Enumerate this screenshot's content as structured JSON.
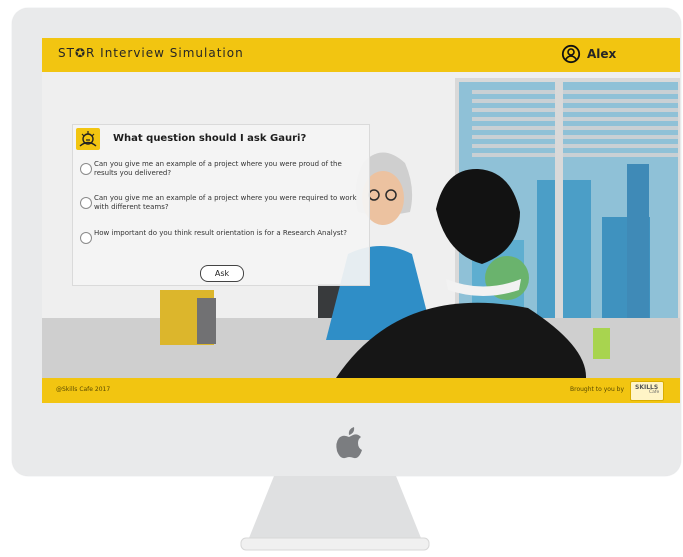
{
  "app": {
    "title": "ST✪R Interview Simulation",
    "user_name": "Alex"
  },
  "question_panel": {
    "question": "What question should I ask Gauri?",
    "options": [
      "Can you give me an example of a project where you were proud of the results you delivered?",
      "Can you give me an example of a project where you were required to work with different teams?",
      "How important do you think result orientation is for a Research Analyst?"
    ],
    "ask_label": "Ask"
  },
  "footer": {
    "copyright": "@Skills Cafe 2017",
    "brought_by": "Brought to you by",
    "logo_text": "SKILLS",
    "logo_sub": "Cafe"
  },
  "colors": {
    "accent": "#f2c511",
    "monitor": "#e9eaeb",
    "woman_shirt": "#2f8ec7",
    "man_hair": "#121212",
    "chair": "#35373a",
    "desk": "#cfcfcf",
    "sky": "#8bc1d7"
  },
  "icons": {
    "user": "user-circle-icon",
    "panel": "character-icon",
    "apple": "apple-logo-icon"
  }
}
